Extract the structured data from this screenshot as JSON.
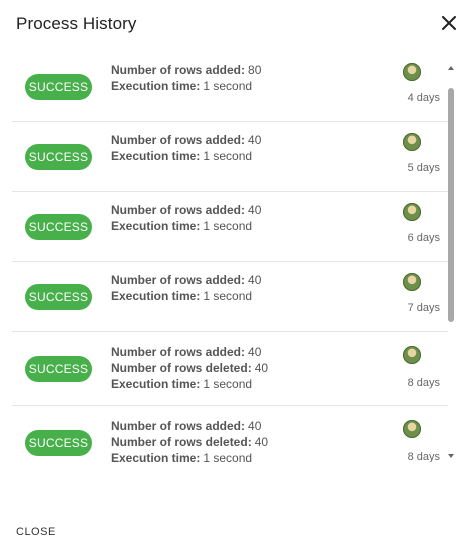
{
  "dialog": {
    "title": "Process History",
    "close_icon": "close-icon",
    "footer_button_label": "CLOSE"
  },
  "labels": {
    "rows_added": "Number of rows added:",
    "rows_deleted": "Number of rows deleted:",
    "execution_time": "Execution time:"
  },
  "colors": {
    "success": "#47b04b",
    "divider": "#e4e4e4"
  },
  "history": [
    {
      "status": "SUCCESS",
      "rows_added": "80",
      "rows_deleted": null,
      "execution_time": "1 second",
      "age": "4 days",
      "avatar_icon": "user-avatar-icon"
    },
    {
      "status": "SUCCESS",
      "rows_added": "40",
      "rows_deleted": null,
      "execution_time": "1 second",
      "age": "5 days",
      "avatar_icon": "user-avatar-icon"
    },
    {
      "status": "SUCCESS",
      "rows_added": "40",
      "rows_deleted": null,
      "execution_time": "1 second",
      "age": "6 days",
      "avatar_icon": "user-avatar-icon"
    },
    {
      "status": "SUCCESS",
      "rows_added": "40",
      "rows_deleted": null,
      "execution_time": "1 second",
      "age": "7 days",
      "avatar_icon": "user-avatar-icon"
    },
    {
      "status": "SUCCESS",
      "rows_added": "40",
      "rows_deleted": "40",
      "execution_time": "1 second",
      "age": "8 days",
      "avatar_icon": "user-avatar-icon"
    },
    {
      "status": "SUCCESS",
      "rows_added": "40",
      "rows_deleted": "40",
      "execution_time": "1 second",
      "age": "8 days",
      "avatar_icon": "user-avatar-icon"
    }
  ]
}
